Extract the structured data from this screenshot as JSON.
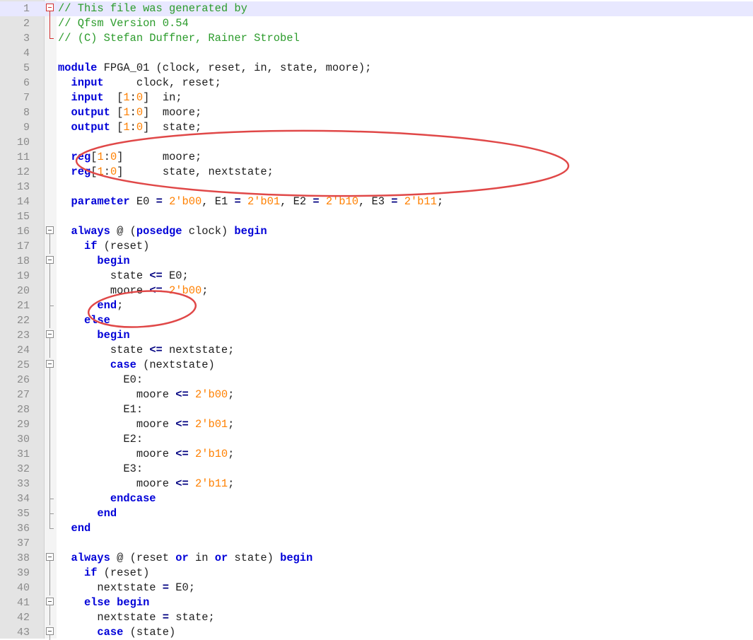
{
  "editor": {
    "lines": [
      {
        "n": "1",
        "fold": "box-red",
        "tokens": [
          {
            "t": "// This file was generated by",
            "c": "cmt"
          }
        ]
      },
      {
        "n": "2",
        "fold": "line-red",
        "tokens": [
          {
            "t": "// Qfsm Version 0.54",
            "c": "cmt"
          }
        ]
      },
      {
        "n": "3",
        "fold": "end-red",
        "tokens": [
          {
            "t": "// (C) Stefan Duffner, Rainer Strobel",
            "c": "cmt"
          }
        ]
      },
      {
        "n": "4",
        "fold": "",
        "tokens": []
      },
      {
        "n": "5",
        "fold": "",
        "tokens": [
          {
            "t": "module",
            "c": "kw"
          },
          {
            "t": " FPGA_01 (clock, reset, in, state, moore);",
            "c": "plain"
          }
        ]
      },
      {
        "n": "6",
        "fold": "",
        "tokens": [
          {
            "t": "  ",
            "c": "plain"
          },
          {
            "t": "input",
            "c": "kw"
          },
          {
            "t": "     clock, reset;",
            "c": "plain"
          }
        ]
      },
      {
        "n": "7",
        "fold": "",
        "tokens": [
          {
            "t": "  ",
            "c": "plain"
          },
          {
            "t": "input",
            "c": "kw"
          },
          {
            "t": "  [",
            "c": "plain"
          },
          {
            "t": "1",
            "c": "num"
          },
          {
            "t": ":",
            "c": "plain"
          },
          {
            "t": "0",
            "c": "num"
          },
          {
            "t": "]  in;",
            "c": "plain"
          }
        ]
      },
      {
        "n": "8",
        "fold": "",
        "tokens": [
          {
            "t": "  ",
            "c": "plain"
          },
          {
            "t": "output",
            "c": "kw"
          },
          {
            "t": " [",
            "c": "plain"
          },
          {
            "t": "1",
            "c": "num"
          },
          {
            "t": ":",
            "c": "plain"
          },
          {
            "t": "0",
            "c": "num"
          },
          {
            "t": "]  moore;",
            "c": "plain"
          }
        ]
      },
      {
        "n": "9",
        "fold": "",
        "tokens": [
          {
            "t": "  ",
            "c": "plain"
          },
          {
            "t": "output",
            "c": "kw"
          },
          {
            "t": " [",
            "c": "plain"
          },
          {
            "t": "1",
            "c": "num"
          },
          {
            "t": ":",
            "c": "plain"
          },
          {
            "t": "0",
            "c": "num"
          },
          {
            "t": "]  state;",
            "c": "plain"
          }
        ]
      },
      {
        "n": "10",
        "fold": "",
        "tokens": []
      },
      {
        "n": "11",
        "fold": "",
        "tokens": [
          {
            "t": "  ",
            "c": "plain"
          },
          {
            "t": "reg",
            "c": "kw"
          },
          {
            "t": "[",
            "c": "plain"
          },
          {
            "t": "1",
            "c": "num"
          },
          {
            "t": ":",
            "c": "plain"
          },
          {
            "t": "0",
            "c": "num"
          },
          {
            "t": "]      moore;",
            "c": "plain"
          }
        ]
      },
      {
        "n": "12",
        "fold": "",
        "tokens": [
          {
            "t": "  ",
            "c": "plain"
          },
          {
            "t": "reg",
            "c": "kw"
          },
          {
            "t": "[",
            "c": "plain"
          },
          {
            "t": "1",
            "c": "num"
          },
          {
            "t": ":",
            "c": "plain"
          },
          {
            "t": "0",
            "c": "num"
          },
          {
            "t": "]      state, nextstate;",
            "c": "plain"
          }
        ]
      },
      {
        "n": "13",
        "fold": "",
        "tokens": []
      },
      {
        "n": "14",
        "fold": "",
        "tokens": [
          {
            "t": "  ",
            "c": "plain"
          },
          {
            "t": "parameter",
            "c": "kw"
          },
          {
            "t": " E0 ",
            "c": "plain"
          },
          {
            "t": "=",
            "c": "op"
          },
          {
            "t": " ",
            "c": "plain"
          },
          {
            "t": "2'b00",
            "c": "num"
          },
          {
            "t": ", E1 ",
            "c": "plain"
          },
          {
            "t": "=",
            "c": "op"
          },
          {
            "t": " ",
            "c": "plain"
          },
          {
            "t": "2'b01",
            "c": "num"
          },
          {
            "t": ", E2 ",
            "c": "plain"
          },
          {
            "t": "=",
            "c": "op"
          },
          {
            "t": " ",
            "c": "plain"
          },
          {
            "t": "2'b10",
            "c": "num"
          },
          {
            "t": ", E3 ",
            "c": "plain"
          },
          {
            "t": "=",
            "c": "op"
          },
          {
            "t": " ",
            "c": "plain"
          },
          {
            "t": "2'b11",
            "c": "num"
          },
          {
            "t": ";",
            "c": "plain"
          }
        ]
      },
      {
        "n": "15",
        "fold": "",
        "tokens": []
      },
      {
        "n": "16",
        "fold": "box",
        "tokens": [
          {
            "t": "  ",
            "c": "plain"
          },
          {
            "t": "always",
            "c": "kw"
          },
          {
            "t": " @ (",
            "c": "plain"
          },
          {
            "t": "posedge",
            "c": "kw"
          },
          {
            "t": " clock) ",
            "c": "plain"
          },
          {
            "t": "begin",
            "c": "kw"
          }
        ]
      },
      {
        "n": "17",
        "fold": "line",
        "tokens": [
          {
            "t": "    ",
            "c": "plain"
          },
          {
            "t": "if",
            "c": "kw"
          },
          {
            "t": " (reset)",
            "c": "plain"
          }
        ]
      },
      {
        "n": "18",
        "fold": "box",
        "tokens": [
          {
            "t": "      ",
            "c": "plain"
          },
          {
            "t": "begin",
            "c": "kw"
          }
        ]
      },
      {
        "n": "19",
        "fold": "line",
        "tokens": [
          {
            "t": "        state ",
            "c": "plain"
          },
          {
            "t": "<=",
            "c": "op"
          },
          {
            "t": " E0;",
            "c": "plain"
          }
        ]
      },
      {
        "n": "20",
        "fold": "line",
        "tokens": [
          {
            "t": "        moore ",
            "c": "plain"
          },
          {
            "t": "<=",
            "c": "op"
          },
          {
            "t": " ",
            "c": "plain"
          },
          {
            "t": "2'b00",
            "c": "num"
          },
          {
            "t": ";",
            "c": "plain"
          }
        ]
      },
      {
        "n": "21",
        "fold": "tick",
        "tokens": [
          {
            "t": "      ",
            "c": "plain"
          },
          {
            "t": "end",
            "c": "kw"
          },
          {
            "t": ";",
            "c": "plain"
          }
        ]
      },
      {
        "n": "22",
        "fold": "line",
        "tokens": [
          {
            "t": "    ",
            "c": "plain"
          },
          {
            "t": "else",
            "c": "kw"
          }
        ]
      },
      {
        "n": "23",
        "fold": "box",
        "tokens": [
          {
            "t": "      ",
            "c": "plain"
          },
          {
            "t": "begin",
            "c": "kw"
          }
        ]
      },
      {
        "n": "24",
        "fold": "line",
        "tokens": [
          {
            "t": "        state ",
            "c": "plain"
          },
          {
            "t": "<=",
            "c": "op"
          },
          {
            "t": " nextstate;",
            "c": "plain"
          }
        ]
      },
      {
        "n": "25",
        "fold": "box",
        "tokens": [
          {
            "t": "        ",
            "c": "plain"
          },
          {
            "t": "case",
            "c": "kw"
          },
          {
            "t": " (nextstate)",
            "c": "plain"
          }
        ]
      },
      {
        "n": "26",
        "fold": "line",
        "tokens": [
          {
            "t": "          E0:",
            "c": "plain"
          }
        ]
      },
      {
        "n": "27",
        "fold": "line",
        "tokens": [
          {
            "t": "            moore ",
            "c": "plain"
          },
          {
            "t": "<=",
            "c": "op"
          },
          {
            "t": " ",
            "c": "plain"
          },
          {
            "t": "2'b00",
            "c": "num"
          },
          {
            "t": ";",
            "c": "plain"
          }
        ]
      },
      {
        "n": "28",
        "fold": "line",
        "tokens": [
          {
            "t": "          E1:",
            "c": "plain"
          }
        ]
      },
      {
        "n": "29",
        "fold": "line",
        "tokens": [
          {
            "t": "            moore ",
            "c": "plain"
          },
          {
            "t": "<=",
            "c": "op"
          },
          {
            "t": " ",
            "c": "plain"
          },
          {
            "t": "2'b01",
            "c": "num"
          },
          {
            "t": ";",
            "c": "plain"
          }
        ]
      },
      {
        "n": "30",
        "fold": "line",
        "tokens": [
          {
            "t": "          E2:",
            "c": "plain"
          }
        ]
      },
      {
        "n": "31",
        "fold": "line",
        "tokens": [
          {
            "t": "            moore ",
            "c": "plain"
          },
          {
            "t": "<=",
            "c": "op"
          },
          {
            "t": " ",
            "c": "plain"
          },
          {
            "t": "2'b10",
            "c": "num"
          },
          {
            "t": ";",
            "c": "plain"
          }
        ]
      },
      {
        "n": "32",
        "fold": "line",
        "tokens": [
          {
            "t": "          E3:",
            "c": "plain"
          }
        ]
      },
      {
        "n": "33",
        "fold": "line",
        "tokens": [
          {
            "t": "            moore ",
            "c": "plain"
          },
          {
            "t": "<=",
            "c": "op"
          },
          {
            "t": " ",
            "c": "plain"
          },
          {
            "t": "2'b11",
            "c": "num"
          },
          {
            "t": ";",
            "c": "plain"
          }
        ]
      },
      {
        "n": "34",
        "fold": "tick",
        "tokens": [
          {
            "t": "        ",
            "c": "plain"
          },
          {
            "t": "endcase",
            "c": "kw"
          }
        ]
      },
      {
        "n": "35",
        "fold": "tick",
        "tokens": [
          {
            "t": "      ",
            "c": "plain"
          },
          {
            "t": "end",
            "c": "kw"
          }
        ]
      },
      {
        "n": "36",
        "fold": "end",
        "tokens": [
          {
            "t": "  ",
            "c": "plain"
          },
          {
            "t": "end",
            "c": "kw"
          }
        ]
      },
      {
        "n": "37",
        "fold": "",
        "tokens": []
      },
      {
        "n": "38",
        "fold": "box",
        "tokens": [
          {
            "t": "  ",
            "c": "plain"
          },
          {
            "t": "always",
            "c": "kw"
          },
          {
            "t": " @ (reset ",
            "c": "plain"
          },
          {
            "t": "or",
            "c": "kw"
          },
          {
            "t": " in ",
            "c": "plain"
          },
          {
            "t": "or",
            "c": "kw"
          },
          {
            "t": " state) ",
            "c": "plain"
          },
          {
            "t": "begin",
            "c": "kw"
          }
        ]
      },
      {
        "n": "39",
        "fold": "line",
        "tokens": [
          {
            "t": "    ",
            "c": "plain"
          },
          {
            "t": "if",
            "c": "kw"
          },
          {
            "t": " (reset)",
            "c": "plain"
          }
        ]
      },
      {
        "n": "40",
        "fold": "line",
        "tokens": [
          {
            "t": "      nextstate ",
            "c": "plain"
          },
          {
            "t": "=",
            "c": "op"
          },
          {
            "t": " E0;",
            "c": "plain"
          }
        ]
      },
      {
        "n": "41",
        "fold": "box",
        "tokens": [
          {
            "t": "    ",
            "c": "plain"
          },
          {
            "t": "else",
            "c": "kw"
          },
          {
            "t": " ",
            "c": "plain"
          },
          {
            "t": "begin",
            "c": "kw"
          }
        ]
      },
      {
        "n": "42",
        "fold": "line",
        "tokens": [
          {
            "t": "      nextstate ",
            "c": "plain"
          },
          {
            "t": "=",
            "c": "op"
          },
          {
            "t": " state;",
            "c": "plain"
          }
        ]
      },
      {
        "n": "43",
        "fold": "box",
        "tokens": [
          {
            "t": "      ",
            "c": "plain"
          },
          {
            "t": "case",
            "c": "kw"
          },
          {
            "t": " (state)",
            "c": "plain"
          }
        ]
      }
    ],
    "current_line": "1",
    "colors": {
      "keyword": "#0000d8",
      "number": "#ff8000",
      "comment": "#2b9b2b",
      "annotation": "#e04848"
    }
  },
  "annotations": [
    {
      "name": "annotation-ellipse-reg-declarations",
      "shape": "ellipse",
      "color": "#e04848"
    },
    {
      "name": "annotation-ellipse-end-statement",
      "shape": "ellipse",
      "color": "#e04848"
    }
  ]
}
